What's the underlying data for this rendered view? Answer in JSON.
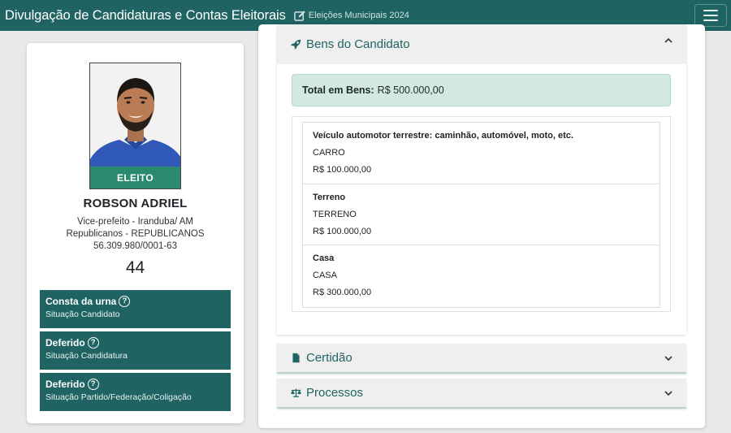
{
  "header": {
    "title": "Divulgação de Candidaturas e Contas Eleitorais",
    "subtitle": "Eleições Municipais 2024",
    "edit_icon": "edit-icon",
    "menu_icon": "hamburger-icon"
  },
  "candidate": {
    "status_badge": "ELEITO",
    "name": "ROBSON ADRIEL",
    "office": "Vice-prefeito - Iranduba/ AM",
    "party": "Republicanos - REPUBLICANOS",
    "cnpj": "56.309.980/0001-63",
    "number": "44",
    "status_boxes": [
      {
        "title": "Consta da urna",
        "subtitle": "Situação Candidato"
      },
      {
        "title": "Deferido",
        "subtitle": "Situação Candidatura"
      },
      {
        "title": "Deferido",
        "subtitle": "Situação Partido/Federação/Coligação"
      }
    ],
    "help_icon": "question-circle-icon"
  },
  "bens": {
    "header": "Bens do Candidato",
    "icon": "rocket-icon",
    "total_label": "Total em Bens:",
    "total_value": "R$ 500.000,00",
    "items": [
      {
        "type": "Veículo automotor terrestre: caminhão, automóvel, moto, etc.",
        "description": "CARRO",
        "value": "R$ 100.000,00"
      },
      {
        "type": "Terreno",
        "description": "TERRENO",
        "value": "R$ 100.000,00"
      },
      {
        "type": "Casa",
        "description": "CASA",
        "value": "R$ 300.000,00"
      }
    ]
  },
  "sections": [
    {
      "label": "Certidão",
      "icon": "file-icon"
    },
    {
      "label": "Processos",
      "icon": "balance-scale-icon"
    }
  ],
  "colors": {
    "primary": "#1f6462",
    "elected": "#2b8a6d",
    "total_bg": "#d3e8de"
  }
}
